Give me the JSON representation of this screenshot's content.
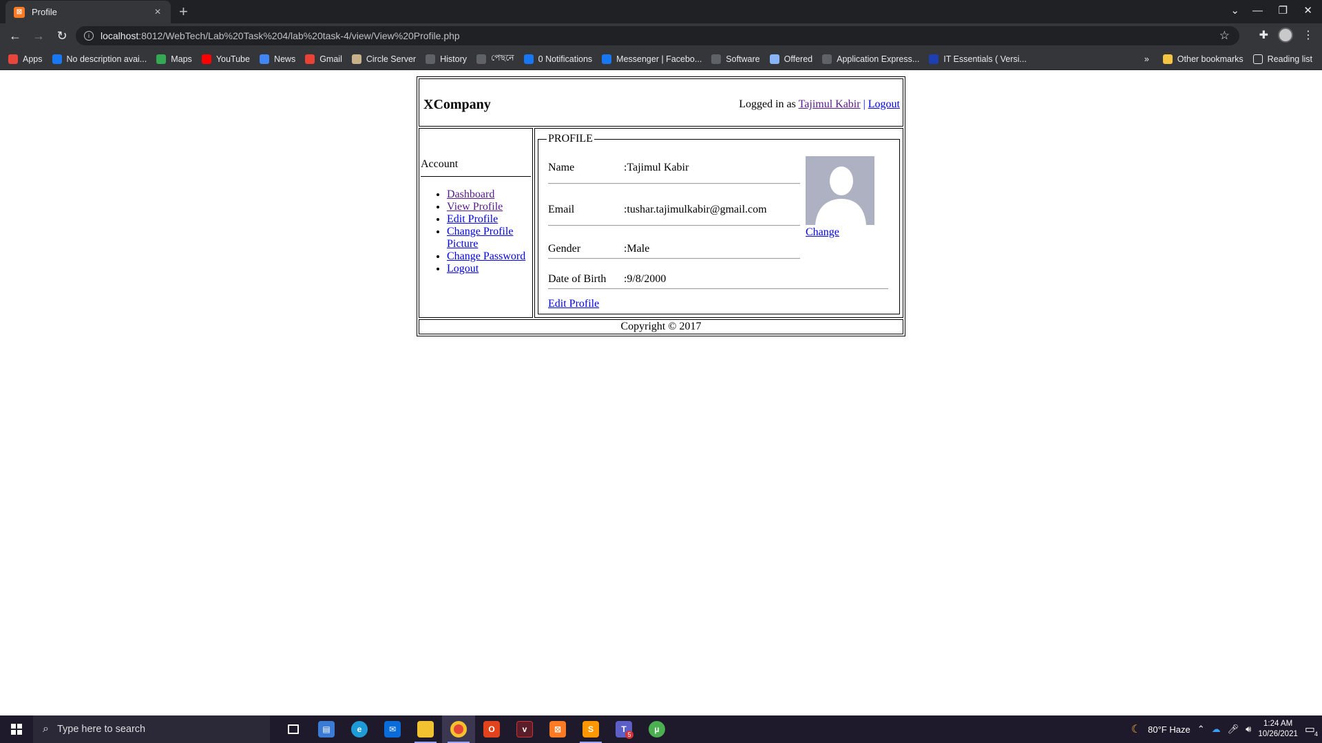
{
  "browser": {
    "tab_title": "Profile",
    "tab_close": "×",
    "new_tab": "+",
    "url_host": "localhost",
    "url_path": ":8012/WebTech/Lab%20Task%204/lab%20task-4/view/View%20Profile.php",
    "bookmarks": [
      {
        "label": "Apps",
        "icon": "apps-grid-icon",
        "color": "#e8453c"
      },
      {
        "label": "No description avai...",
        "icon": "facebook-icon",
        "color": "#1877f2"
      },
      {
        "label": "Maps",
        "icon": "maps-icon",
        "color": "#34a853"
      },
      {
        "label": "YouTube",
        "icon": "youtube-icon",
        "color": "#ff0000"
      },
      {
        "label": "News",
        "icon": "news-icon",
        "color": "#4285f4"
      },
      {
        "label": "Gmail",
        "icon": "gmail-icon",
        "color": "#ea4335"
      },
      {
        "label": "Circle Server",
        "icon": "circle-server-icon",
        "color": "#c9b28a"
      },
      {
        "label": "History",
        "icon": "history-icon",
        "color": "#5f6368"
      },
      {
        "label": "পেছনে",
        "icon": "globe-icon",
        "color": "#5f6368"
      },
      {
        "label": "0 Notifications",
        "icon": "facebook-icon",
        "color": "#1877f2"
      },
      {
        "label": "Messenger | Facebo...",
        "icon": "facebook-icon",
        "color": "#1877f2"
      },
      {
        "label": "Software",
        "icon": "globe-icon",
        "color": "#5f6368"
      },
      {
        "label": "Offered",
        "icon": "shield-icon",
        "color": "#8ab4f8"
      },
      {
        "label": "Application Express...",
        "icon": "globe-icon",
        "color": "#5f6368"
      },
      {
        "label": "IT Essentials ( Versi...",
        "icon": "cisco-icon",
        "color": "#1d3fb2"
      }
    ],
    "bookmarks_more": "»",
    "other_bookmarks": "Other bookmarks",
    "reading_list": "Reading list"
  },
  "site": {
    "brand": "XCompany",
    "logged_in_as": "Logged in as",
    "user_name": "Tajimul Kabir",
    "separator": "|",
    "logout": "Logout",
    "sidebar_title": "Account",
    "menu": [
      "Dashboard",
      "View Profile",
      "Edit Profile",
      "Change Profile Picture",
      "Change Password",
      "Logout"
    ],
    "profile_legend": "PROFILE",
    "fields": [
      {
        "label": "Name",
        "value": ":Tajimul Kabir"
      },
      {
        "label": "Email",
        "value": ":tushar.tajimulkabir@gmail.com"
      },
      {
        "label": "Gender",
        "value": ":Male"
      },
      {
        "label": "Date of Birth",
        "value": ":9/8/2000"
      }
    ],
    "change_link": "Change",
    "edit_profile_link": "Edit Profile",
    "footer": "Copyright © 2017"
  },
  "taskbar": {
    "search_placeholder": "Type here to search",
    "weather": "80°F  Haze",
    "time": "1:24 AM",
    "date": "10/26/2021",
    "teams_badge": "5",
    "notif_count": "4"
  }
}
